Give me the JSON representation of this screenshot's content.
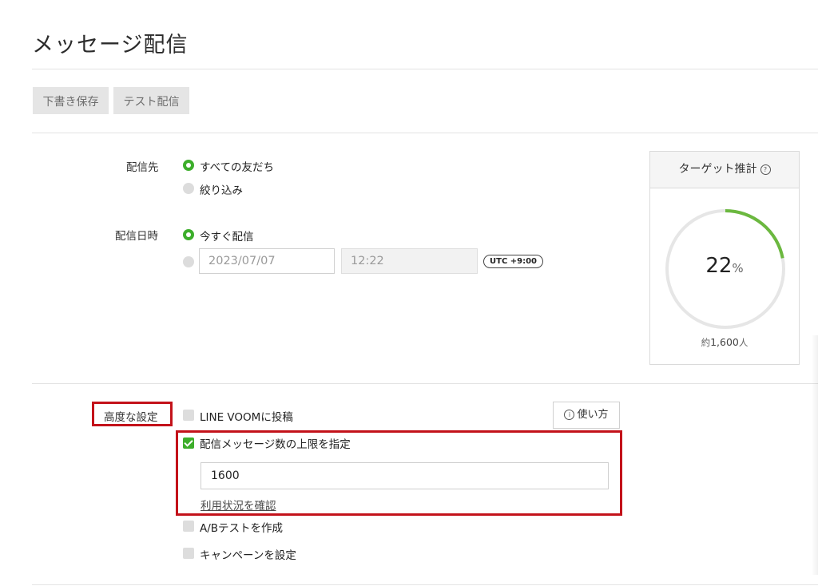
{
  "page": {
    "title": "メッセージ配信"
  },
  "toolbar": {
    "save_draft": "下書き保存",
    "test_send": "テスト配信"
  },
  "destination": {
    "label": "配信先",
    "options": [
      {
        "label": "すべての友だち",
        "selected": true
      },
      {
        "label": "絞り込み",
        "selected": false
      }
    ]
  },
  "schedule": {
    "label": "配信日時",
    "options": [
      {
        "label": "今すぐ配信",
        "selected": true
      }
    ],
    "date_value": "2023/07/07",
    "time_value": "12:22",
    "timezone": "UTC +9:00"
  },
  "target": {
    "title": "ターゲット推計",
    "help_icon": "question-circle-icon",
    "percent": "22",
    "percent_unit": "%",
    "percent_value": 22,
    "approx_prefix": "約",
    "approx_count": "1,600",
    "approx_unit": "人",
    "ring_color": "#6bb83f"
  },
  "advanced": {
    "label": "高度な設定",
    "how_to_button": "使い方",
    "how_to_icon": "info-circle-icon",
    "line_voom": {
      "label": "LINE VOOMに投稿",
      "checked": false
    },
    "limit": {
      "label": "配信メッセージ数の上限を指定",
      "checked": true,
      "value": "1600",
      "usage_link": "利用状況を確認"
    },
    "ab_test": {
      "label": "A/Bテストを作成",
      "checked": false
    },
    "campaign": {
      "label": "キャンペーンを設定",
      "checked": false
    }
  },
  "colors": {
    "accent_green": "#3dae2b",
    "highlight_red": "#c3121a"
  }
}
